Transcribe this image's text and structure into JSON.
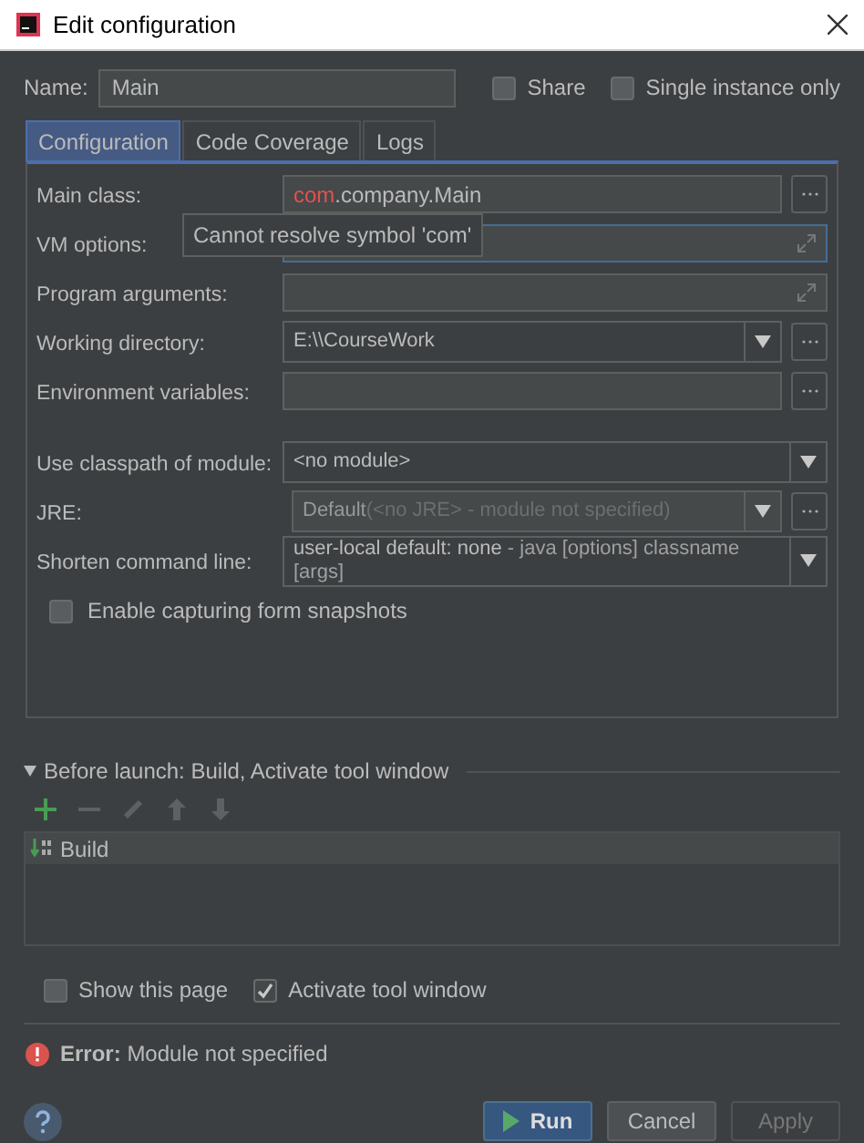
{
  "window": {
    "title": "Edit configuration"
  },
  "name_field": {
    "label": "Name:",
    "value": "Main"
  },
  "options": [
    {
      "label": "Share",
      "checked": false
    },
    {
      "label": "Single instance only",
      "checked": false
    }
  ],
  "tabs": [
    {
      "label": "Configuration",
      "selected": true
    },
    {
      "label": "Code Coverage",
      "selected": false
    },
    {
      "label": "Logs",
      "selected": false
    }
  ],
  "fields": [
    {
      "kind": "text",
      "label": "Main class:",
      "error_part": "com",
      "value": ".company.Main",
      "browse": true,
      "focused": false
    },
    {
      "kind": "expand",
      "label": "VM options:",
      "browse": false,
      "focused": true
    },
    {
      "kind": "expand",
      "label": "Program arguments:",
      "browse": false,
      "focused": false
    },
    {
      "kind": "combo",
      "label": "Working directory:",
      "value": "E:\\\\CourseWork",
      "browse": true,
      "disabled": false
    },
    {
      "kind": "text",
      "label": "Environment variables:",
      "browse": true,
      "focused": false
    },
    {
      "kind": "gap"
    },
    {
      "kind": "combo",
      "label": "Use classpath of module:",
      "value": "<no module>",
      "browse": false,
      "disabled": false
    },
    {
      "kind": "combo",
      "label": "JRE:",
      "value": "Default",
      "hint": "(<no JRE> - module not specified)",
      "browse": true,
      "disabled": true
    },
    {
      "kind": "combo",
      "label": "Shorten command line:",
      "value": "user-local default: none",
      "hint": " - java [options] classname [args]",
      "browse": false,
      "disabled": false
    }
  ],
  "tooltip": "Cannot resolve symbol 'com'",
  "snapshots": {
    "label": "Enable capturing form snapshots",
    "checked": false
  },
  "before_launch": {
    "title": "Before launch: Build, Activate tool window",
    "expanded": true,
    "toolbar": [
      {
        "kind": "add",
        "disabled": false
      },
      {
        "kind": "remove",
        "disabled": true
      },
      {
        "kind": "edit",
        "disabled": true
      },
      {
        "kind": "up",
        "disabled": true
      },
      {
        "kind": "down",
        "disabled": true
      }
    ],
    "tasks": [
      {
        "label": "Build",
        "selected": true
      }
    ]
  },
  "bottom_options": [
    {
      "label": "Show this page",
      "checked": false
    },
    {
      "label": "Activate tool window",
      "checked": true
    }
  ],
  "error": {
    "label": "Error:",
    "message": "Module not specified"
  },
  "buttons": [
    {
      "label": "Run",
      "kind": "primary",
      "disabled": false
    },
    {
      "label": "Cancel",
      "kind": "normal",
      "disabled": false
    },
    {
      "label": "Apply",
      "kind": "normal",
      "disabled": true
    }
  ]
}
